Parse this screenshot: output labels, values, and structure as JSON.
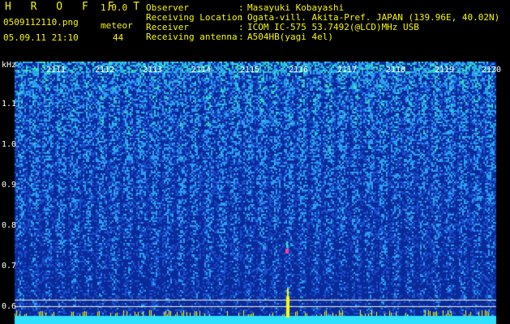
{
  "header": {
    "app_title": "H R O F F T",
    "app_version": "1.0.0",
    "file_name": "0509112110.png",
    "mode_label": "meteor",
    "datetime": "05.09.11 21:10",
    "count_value": "44"
  },
  "info": [
    {
      "label": "Observer",
      "value": "Masayuki Kobayashi"
    },
    {
      "label": "Receiving Location",
      "value": "Ogata-vill. Akita-Pref. JAPAN (139.96E, 40.02N)"
    },
    {
      "label": "Receiver",
      "value": "ICOM IC-575 53.7492(@LCD)MHz USB"
    },
    {
      "label": "Receiving antenna",
      "value": "A504HB(yagi 4el)"
    }
  ],
  "spectrogram": {
    "unit_label": "kHz",
    "time_labels": [
      "2111",
      "2112",
      "2113",
      "2114",
      "2115",
      "2116",
      "2117",
      "2118",
      "2119",
      "2120"
    ],
    "freq_labels": [
      "1.1",
      "1.0",
      "0.9",
      "0.8",
      "0.7",
      "0.6"
    ],
    "colors": {
      "background": "#0a2a9a",
      "noise_low": "#1a50d0",
      "noise_mid": "#2aa0f0",
      "noise_high": "#30e0c0",
      "hot": "#ffff00",
      "meteor": "#ff40a0",
      "baseline": "#30e0ff",
      "guide_line": "#f0f0c0"
    }
  }
}
